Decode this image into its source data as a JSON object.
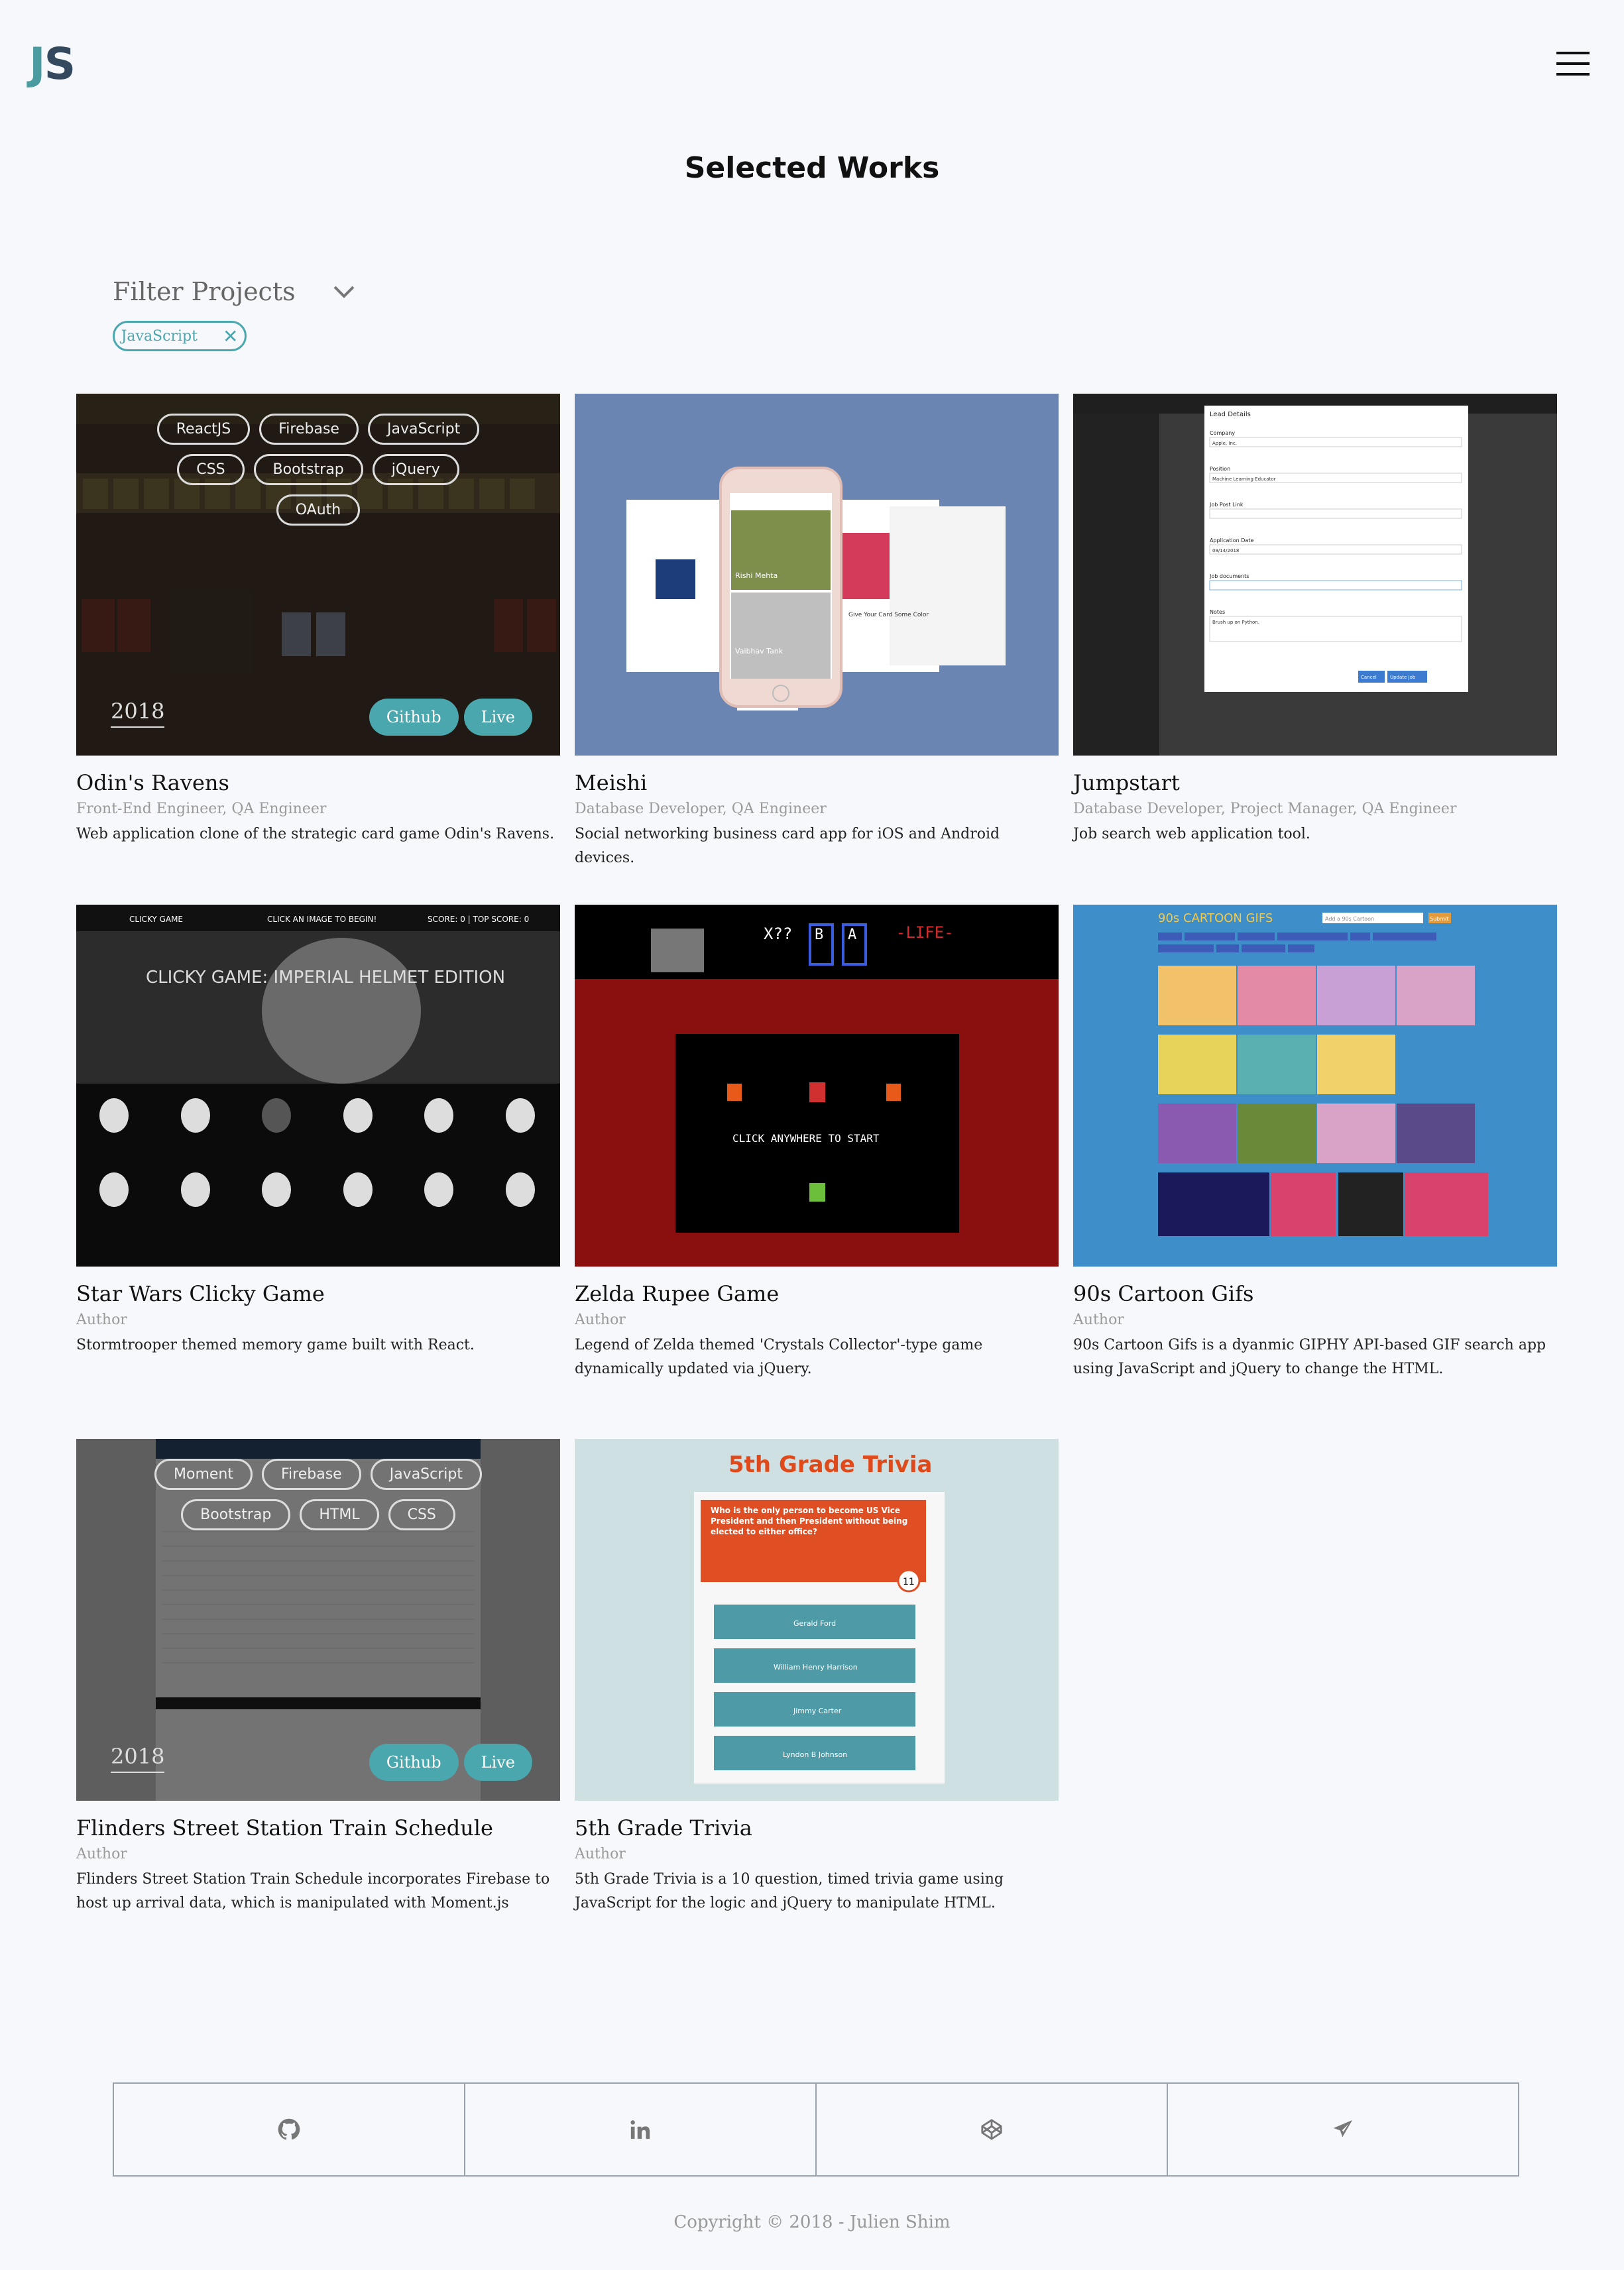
{
  "header": {
    "logo_j": "J",
    "logo_s": "S"
  },
  "page_title": "Selected Works",
  "filter": {
    "label": "Filter Projects",
    "active_chip": "JavaScript"
  },
  "projects": [
    {
      "title": "Odin's Ravens",
      "roles": "Front-End Engineer, QA Engineer",
      "desc": "Web application clone of the strategic card game Odin's Ravens.",
      "tags": [
        "ReactJS",
        "Firebase",
        "JavaScript",
        "CSS",
        "Bootstrap",
        "jQuery",
        "OAuth"
      ],
      "year": "2018",
      "github": "Github",
      "live": "Live"
    },
    {
      "title": "Meishi",
      "roles": "Database Developer, QA Engineer",
      "desc": "Social networking business card app for iOS and Android devices."
    },
    {
      "title": "Jumpstart",
      "roles": "Database Developer, Project Manager, QA Engineer",
      "desc": "Job search web application tool."
    },
    {
      "title": "Star Wars Clicky Game",
      "roles": "Author",
      "desc": "Stormtrooper themed memory game built with React."
    },
    {
      "title": "Zelda Rupee Game",
      "roles": "Author",
      "desc": "Legend of Zelda themed 'Crystals Collector'-type game dynamically updated via jQuery."
    },
    {
      "title": "90s Cartoon Gifs",
      "roles": "Author",
      "desc": "90s Cartoon Gifs is a dyanmic GIPHY API-based GIF search app using JavaScript and jQuery to change the HTML."
    },
    {
      "title": "Flinders Street Station Train Schedule",
      "roles": "Author",
      "desc": "Flinders Street Station Train Schedule incorporates Firebase to host up arrival data, which is manipulated with Moment.js",
      "tags": [
        "Moment",
        "Firebase",
        "JavaScript",
        "Bootstrap",
        "HTML",
        "CSS"
      ],
      "year": "2018",
      "github": "Github",
      "live": "Live"
    },
    {
      "title": "5th Grade Trivia",
      "roles": "Author",
      "desc": "5th Grade Trivia is a 10 question, timed trivia game using JavaScript for the logic and jQuery to manipulate HTML."
    }
  ],
  "thumb_text": {
    "meishi_name": "Rishi Mehta",
    "meishi_name2": "Vaibhav Tank",
    "meishi_card": "Give Your Card Some Color",
    "jump_heading": "Lead Details",
    "jump_fields": [
      "Company",
      "Position",
      "Job Post Link",
      "Application Date",
      "Job documents",
      "Notes"
    ],
    "jump_values": [
      "Apple, Inc.",
      "Machine Learning Educator",
      "",
      "08/14/2018",
      "",
      "Brush up on Python."
    ],
    "jump_cancel": "Cancel",
    "jump_update": "Update Job",
    "sw_bar_left": "CLICKY GAME",
    "sw_bar_mid": "CLICK AN IMAGE TO BEGIN!",
    "sw_bar_right": "SCORE: 0  |  TOP SCORE: 0",
    "sw_title": "CLICKY GAME: IMPERIAL HELMET EDITION",
    "zelda_life": "-LIFE-",
    "zelda_x": "X??",
    "zelda_b": "B",
    "zelda_a": "A",
    "zelda_start": "CLICK ANYWHERE TO START",
    "cartoon_title": "90s CARTOON GIFS",
    "cartoon_search": "Add a 90s Cartoon",
    "cartoon_submit": "Submit",
    "trivia_title": "5th Grade Trivia",
    "trivia_question": "Who is the only person to become US Vice President and then President without being elected to either office?",
    "trivia_timer": "11",
    "trivia_answers": [
      "Gerald Ford",
      "William Henry Harrison",
      "Jimmy Carter",
      "Lyndon B Johnson"
    ]
  },
  "footer": {
    "icons": [
      "github-icon",
      "linkedin-icon",
      "codepen-icon",
      "send-icon"
    ],
    "copyright": "Copyright © 2018 - Julien Shim"
  },
  "colors": {
    "accent": "#4aa7ad",
    "background": "#f6f8fb"
  }
}
